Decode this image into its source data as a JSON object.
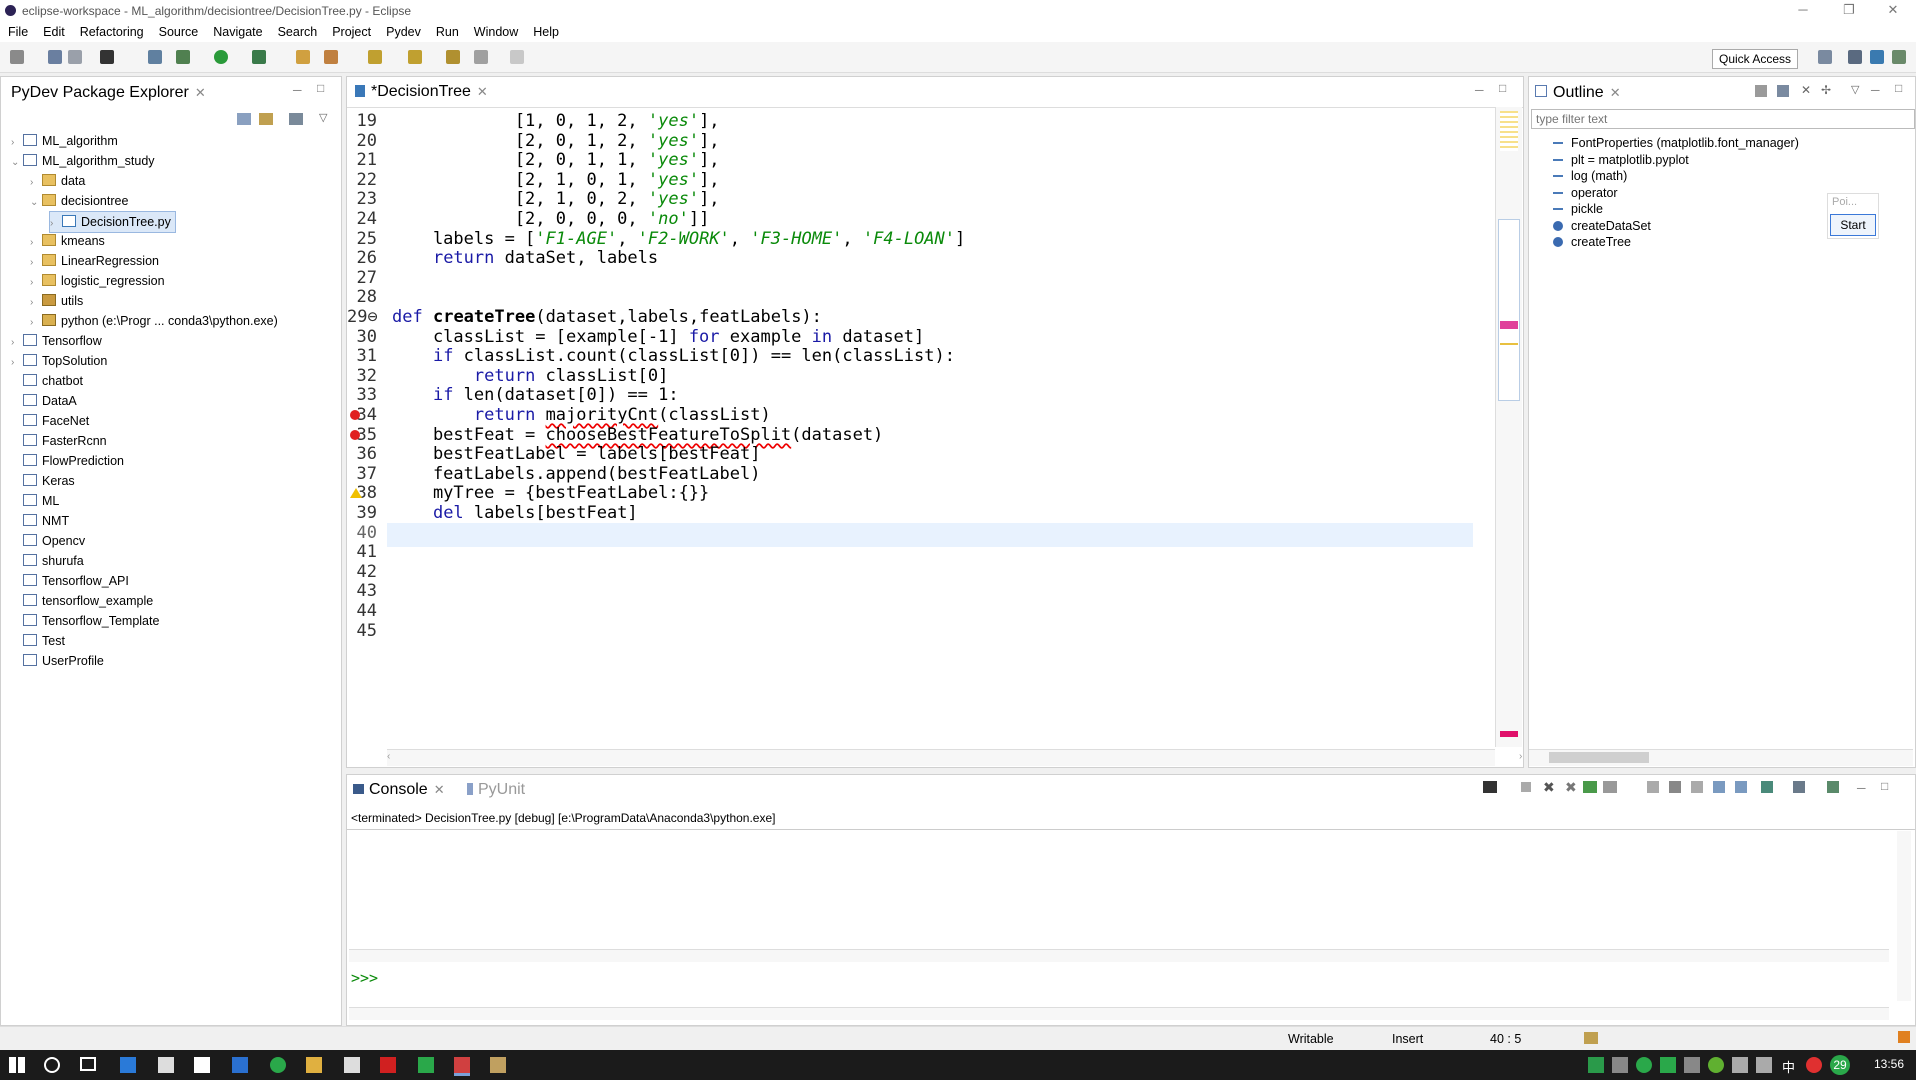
{
  "window": {
    "title": "eclipse-workspace - ML_algorithm/decisiontree/DecisionTree.py - Eclipse"
  },
  "menu": [
    "File",
    "Edit",
    "Refactoring",
    "Source",
    "Navigate",
    "Search",
    "Project",
    "Pydev",
    "Run",
    "Window",
    "Help"
  ],
  "toolbar": {
    "quick_access": "Quick Access"
  },
  "explorer": {
    "title": "PyDev Package Explorer",
    "items": [
      {
        "label": "ML_algorithm",
        "arrow": "›",
        "icon": "proj"
      },
      {
        "label": "ML_algorithm_study",
        "arrow": "⌄",
        "icon": "proj"
      },
      {
        "label": "data",
        "arrow": "›",
        "icon": "folder"
      },
      {
        "label": "decisiontree",
        "arrow": "⌄",
        "icon": "folder"
      },
      {
        "label": "DecisionTree.py",
        "arrow": "›",
        "icon": "pyfile"
      },
      {
        "label": "kmeans",
        "arrow": "›",
        "icon": "folder"
      },
      {
        "label": "LinearRegression",
        "arrow": "›",
        "icon": "folder"
      },
      {
        "label": "logistic_regression",
        "arrow": "›",
        "icon": "folder"
      },
      {
        "label": "utils",
        "arrow": "›",
        "icon": "pkg"
      },
      {
        "label": "python  (e:\\Progr ... conda3\\python.exe)",
        "arrow": "›",
        "icon": "pyproj"
      },
      {
        "label": "Tensorflow",
        "arrow": "›",
        "icon": "proj"
      },
      {
        "label": "TopSolution",
        "arrow": "›",
        "icon": "proj"
      },
      {
        "label": "chatbot",
        "arrow": "",
        "icon": "proj"
      },
      {
        "label": "DataA",
        "arrow": "",
        "icon": "proj"
      },
      {
        "label": "FaceNet",
        "arrow": "",
        "icon": "proj"
      },
      {
        "label": "FasterRcnn",
        "arrow": "",
        "icon": "proj"
      },
      {
        "label": "FlowPrediction",
        "arrow": "",
        "icon": "proj"
      },
      {
        "label": "Keras",
        "arrow": "",
        "icon": "proj"
      },
      {
        "label": "ML",
        "arrow": "",
        "icon": "proj"
      },
      {
        "label": "NMT",
        "arrow": "",
        "icon": "proj"
      },
      {
        "label": "Opencv",
        "arrow": "",
        "icon": "proj"
      },
      {
        "label": "shurufa",
        "arrow": "",
        "icon": "proj"
      },
      {
        "label": "Tensorflow_API",
        "arrow": "",
        "icon": "proj"
      },
      {
        "label": "tensorflow_example",
        "arrow": "",
        "icon": "proj"
      },
      {
        "label": "Tensorflow_Template",
        "arrow": "",
        "icon": "proj"
      },
      {
        "label": "Test",
        "arrow": "",
        "icon": "proj"
      },
      {
        "label": "UserProfile",
        "arrow": "",
        "icon": "proj"
      }
    ]
  },
  "editor": {
    "tab": "*DecisionTree",
    "lines": [
      {
        "n": "19",
        "marker": ""
      },
      {
        "n": "20",
        "marker": ""
      },
      {
        "n": "21",
        "marker": ""
      },
      {
        "n": "22",
        "marker": ""
      },
      {
        "n": "23",
        "marker": ""
      },
      {
        "n": "24",
        "marker": ""
      },
      {
        "n": "25",
        "marker": ""
      },
      {
        "n": "26",
        "marker": ""
      },
      {
        "n": "27",
        "marker": ""
      },
      {
        "n": "28",
        "marker": ""
      },
      {
        "n": "29⊖",
        "marker": ""
      },
      {
        "n": "30",
        "marker": ""
      },
      {
        "n": "31",
        "marker": ""
      },
      {
        "n": "32",
        "marker": ""
      },
      {
        "n": "33",
        "marker": ""
      },
      {
        "n": "34",
        "marker": "err"
      },
      {
        "n": "35",
        "marker": "err"
      },
      {
        "n": "36",
        "marker": ""
      },
      {
        "n": "37",
        "marker": ""
      },
      {
        "n": "38",
        "marker": "warn"
      },
      {
        "n": "39",
        "marker": ""
      },
      {
        "n": "40",
        "marker": ""
      },
      {
        "n": "41",
        "marker": ""
      },
      {
        "n": "42",
        "marker": ""
      },
      {
        "n": "43",
        "marker": ""
      },
      {
        "n": "44",
        "marker": ""
      },
      {
        "n": "45",
        "marker": ""
      }
    ],
    "current_line_index": 21
  },
  "outline": {
    "title": "Outline",
    "filter_placeholder": "type filter text",
    "items": [
      {
        "label": "FontProperties (matplotlib.font_manager)",
        "kind": "import"
      },
      {
        "label": "plt = matplotlib.pyplot",
        "kind": "import"
      },
      {
        "label": "log (math)",
        "kind": "import"
      },
      {
        "label": "operator",
        "kind": "import"
      },
      {
        "label": "pickle",
        "kind": "import"
      },
      {
        "label": "createDataSet",
        "kind": "function"
      },
      {
        "label": "createTree",
        "kind": "function"
      }
    ],
    "popup": {
      "label": "Poi...",
      "start": "Start"
    }
  },
  "console": {
    "tab": "Console",
    "tab2": "PyUnit",
    "status": "<terminated> DecisionTree.py [debug] [e:\\ProgramData\\Anaconda3\\python.exe]",
    "prompt": ">>>"
  },
  "statusbar": {
    "writable": "Writable",
    "mode": "Insert",
    "position": "40 : 5"
  },
  "taskbar": {
    "time": "13:56",
    "badge": "29",
    "ime": "中"
  }
}
